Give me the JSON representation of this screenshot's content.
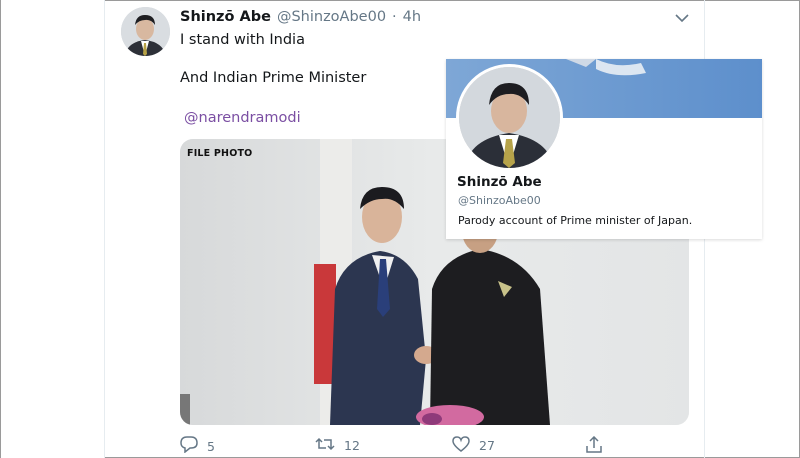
{
  "tweet": {
    "display_name": "Shinzō Abe",
    "handle": "@ShinzoAbe00",
    "separator": "·",
    "timestamp": "4h",
    "lines": [
      "I stand with India",
      "And Indian Prime Minister"
    ],
    "mention": "@narendramodi",
    "photo_label": "FILE PHOTO"
  },
  "actions": {
    "reply_count": "5",
    "retweet_count": "12",
    "like_count": "27"
  },
  "hovercard": {
    "name": "Shinzō Abe",
    "handle": "@ShinzoAbe00",
    "bio": "Parody account of Prime minister of Japan."
  },
  "colors": {
    "text": "#14171a",
    "secondary": "#657786",
    "mention": "#7b4fa3",
    "border": "#e6ecf0"
  },
  "icons": [
    "reply-icon",
    "retweet-icon",
    "like-icon",
    "share-icon",
    "chevron-down-icon"
  ]
}
